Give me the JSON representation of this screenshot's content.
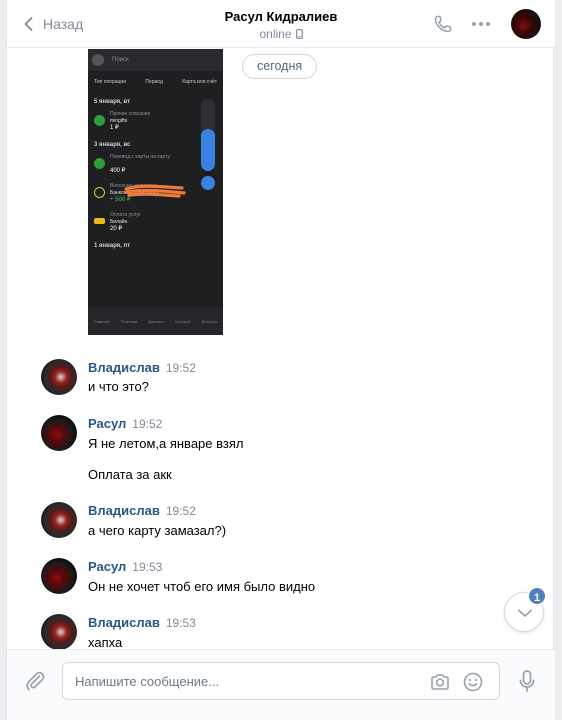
{
  "header": {
    "back_label": "Назад",
    "title": "Расул Кидралиев",
    "status": "online"
  },
  "chat": {
    "date_label": "сегодня",
    "attachment": {
      "search": "Поиск",
      "tabs": [
        "Тип операции",
        "Период",
        "Карта или счёт"
      ],
      "groups": [
        {
          "date": "5 января, вт",
          "rows": [
            {
              "category": "Прочие списания",
              "name": "mingifts",
              "amount": "1 ₽",
              "color": "#2e9d3a"
            }
          ]
        },
        {
          "date": "3 января, вс",
          "rows": [
            {
              "category": "Перевод с карты на карту",
              "name": "",
              "amount": "400 ₽",
              "color": "#2e9d3a"
            },
            {
              "category": "Внесение наличных",
              "name": "Банкомат Сбербанка",
              "amount": "+ 500 ₽",
              "color": "#c8d43a"
            },
            {
              "category": "Оплата услуг",
              "name": "Билайн",
              "amount": "20 ₽",
              "color": "#e8b91c"
            }
          ]
        },
        {
          "date": "1 января, пт",
          "rows": []
        }
      ],
      "nav": [
        "Главный",
        "Платежи",
        "Диалоги",
        "История",
        "Витрина"
      ]
    },
    "messages": [
      {
        "author": "Владислав",
        "time": "19:52",
        "lines": [
          "и что это?"
        ]
      },
      {
        "author": "Расул",
        "time": "19:52",
        "lines": [
          "Я не летом,а январе взял",
          "Оплата за акк"
        ]
      },
      {
        "author": "Владислав",
        "time": "19:52",
        "lines": [
          "а чего карту замазал?)"
        ]
      },
      {
        "author": "Расул",
        "time": "19:53",
        "lines": [
          "Он не хочет чтоб его имя было видно"
        ]
      },
      {
        "author": "Владислав",
        "time": "19:53",
        "lines": [
          "хапха"
        ]
      }
    ],
    "unread_count": "1"
  },
  "composer": {
    "placeholder": "Напишите сообщение..."
  },
  "icons": [
    "chevron-left-icon",
    "phone-icon",
    "more-icon",
    "mobile-icon",
    "paperclip-icon",
    "camera-icon",
    "smile-icon",
    "microphone-icon",
    "chevron-down-icon"
  ],
  "colors": {
    "link": "#2a5885",
    "accent": "#5181b8",
    "muted": "#828a99",
    "background": "#edeef0"
  }
}
